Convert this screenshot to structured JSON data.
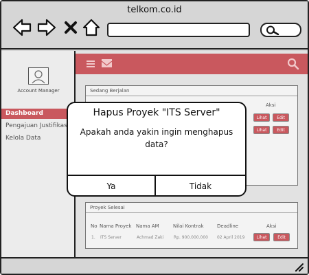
{
  "browser": {
    "title": "telkom.co.id"
  },
  "sidebar": {
    "account_label": "Account Manager",
    "items": [
      {
        "label": "Dashboard"
      },
      {
        "label": "Pengajuan Justifikasi"
      },
      {
        "label": "Kelola Data"
      }
    ]
  },
  "panel_ongoing": {
    "title": "Sedang Berjalan",
    "action_header": "Aksi",
    "view_label": "Lihat",
    "edit_label": "Edit"
  },
  "panel_done": {
    "title": "Proyek Selesai",
    "columns": [
      "No",
      "Nama Proyek",
      "Nama AM",
      "Nilai Kontrak",
      "Deadline",
      "Aksi"
    ],
    "rows": [
      [
        "1.",
        "ITS Server",
        "Achmad Zaki",
        "Rp. 900.000.000",
        "02 April 2019"
      ]
    ],
    "view_label": "Lihat",
    "edit_label": "Edit"
  },
  "dialog": {
    "title": "Hapus Proyek \"ITS Server\"",
    "message": "Apakah anda yakin ingin menghapus data?",
    "confirm_label": "Ya",
    "cancel_label": "Tidak"
  },
  "colors": {
    "accent": "#c9585e",
    "chrome": "#d6d6d6"
  }
}
